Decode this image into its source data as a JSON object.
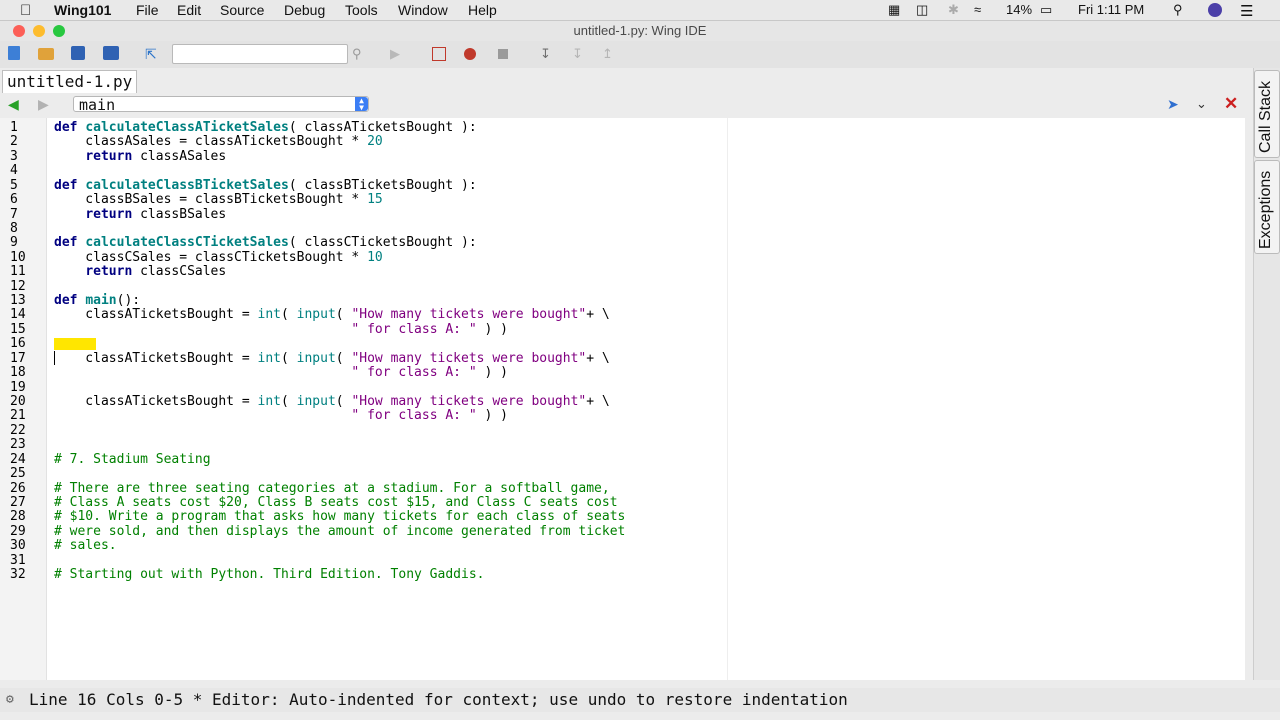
{
  "menubar": {
    "app_name": "Wing101",
    "items": [
      "File",
      "Edit",
      "Source",
      "Debug",
      "Tools",
      "Window",
      "Help"
    ],
    "battery": "14%",
    "clock": "Fri 1:11 PM"
  },
  "window": {
    "title": "untitled-1.py: Wing IDE"
  },
  "editor": {
    "tab_label": "untitled-1.py",
    "scope_value": "main"
  },
  "side_tabs": [
    "Call Stack",
    "Exceptions"
  ],
  "code_lines": [
    "def calculateClassATicketSales( classATicketsBought ):",
    "    classASales = classATicketsBought * 20",
    "    return classASales",
    "",
    "def calculateClassBTicketSales( classBTicketsBought ):",
    "    classBSales = classBTicketsBought * 15",
    "    return classBSales",
    "",
    "def calculateClassCTicketSales( classCTicketsBought ):",
    "    classCSales = classCTicketsBought * 10",
    "    return classCSales",
    "",
    "def main():",
    "    classATicketsBought = int( input( \"How many tickets were bought\"+ \\",
    "                                      \" for class A: \" ) )",
    "",
    "    classATicketsBought = int( input( \"How many tickets were bought\"+ \\",
    "                                      \" for class A: \" ) )",
    "",
    "    classATicketsBought = int( input( \"How many tickets were bought\"+ \\",
    "                                      \" for class A: \" ) )",
    "",
    "",
    "# 7. Stadium Seating",
    "",
    "# There are three seating categories at a stadium. For a softball game,",
    "# Class A seats cost $20, Class B seats cost $15, and Class C seats cost",
    "# $10. Write a program that asks how many tickets for each class of seats",
    "# were sold, and then displays the amount of income generated from ticket",
    "# sales.",
    "",
    "# Starting out with Python. Third Edition. Tony Gaddis."
  ],
  "status": {
    "text": "Line 16 Cols 0-5 * Editor: Auto-indented for context; use undo to restore indentation"
  },
  "colors": {
    "highlight": "#ffe600",
    "keyword": "#000080",
    "function": "#008080",
    "string": "#800080",
    "comment": "#008000"
  }
}
